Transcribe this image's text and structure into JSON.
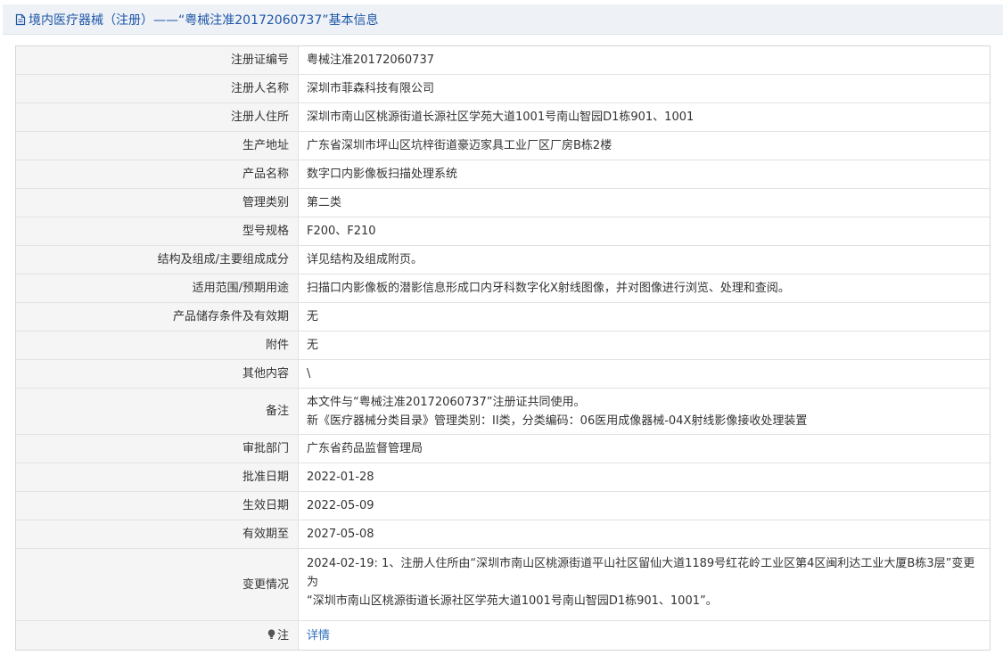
{
  "header": {
    "title": "境内医疗器械（注册）——“粤械注准20172060737”基本信息",
    "icon": "document-icon",
    "accent": "#1e57a8"
  },
  "rows": [
    {
      "label": "注册证编号",
      "value": "粤械注准20172060737"
    },
    {
      "label": "注册人名称",
      "value": "深圳市菲森科技有限公司"
    },
    {
      "label": "注册人住所",
      "value": "深圳市南山区桃源街道长源社区学苑大道1001号南山智园D1栋901、1001"
    },
    {
      "label": "生产地址",
      "value": "广东省深圳市坪山区坑梓街道豪迈家具工业厂区厂房B栋2楼"
    },
    {
      "label": "产品名称",
      "value": "数字口内影像板扫描处理系统"
    },
    {
      "label": "管理类别",
      "value": "第二类"
    },
    {
      "label": "型号规格",
      "value": "F200、F210"
    },
    {
      "label": "结构及组成/主要组成成分",
      "value": "详见结构及组成附页。"
    },
    {
      "label": "适用范围/预期用途",
      "value": "扫描口内影像板的潜影信息形成口内牙科数字化X射线图像，并对图像进行浏览、处理和查阅。"
    },
    {
      "label": "产品储存条件及有效期",
      "value": "无"
    },
    {
      "label": "附件",
      "value": "无"
    },
    {
      "label": "其他内容",
      "value": "\\"
    }
  ],
  "note": {
    "label": "备注",
    "line1": "本文件与“粤械注准20172060737”注册证共同使用。",
    "line2": "新《医疗器械分类目录》管理类别：II类，分类编码：06医用成像器械-04X射线影像接收处理装置"
  },
  "rows2": [
    {
      "label": "审批部门",
      "value": "广东省药品监督管理局"
    },
    {
      "label": "批准日期",
      "value": "2022-01-28"
    },
    {
      "label": "生效日期",
      "value": "2022-05-09"
    },
    {
      "label": "有效期至",
      "value": "2027-05-08"
    }
  ],
  "change": {
    "label": "变更情况",
    "line1": "2024-02-19: 1、注册人住所由“深圳市南山区桃源街道平山社区留仙大道1189号红花岭工业区第4区闽利达工业大厦B栋3层”变更为",
    "line2": "“深圳市南山区桃源街道长源社区学苑大道1001号南山智园D1栋901、1001”。"
  },
  "detail": {
    "label": "注",
    "icon": "lightbulb-icon",
    "link": "详情",
    "link_color": "#2f6fbd"
  }
}
